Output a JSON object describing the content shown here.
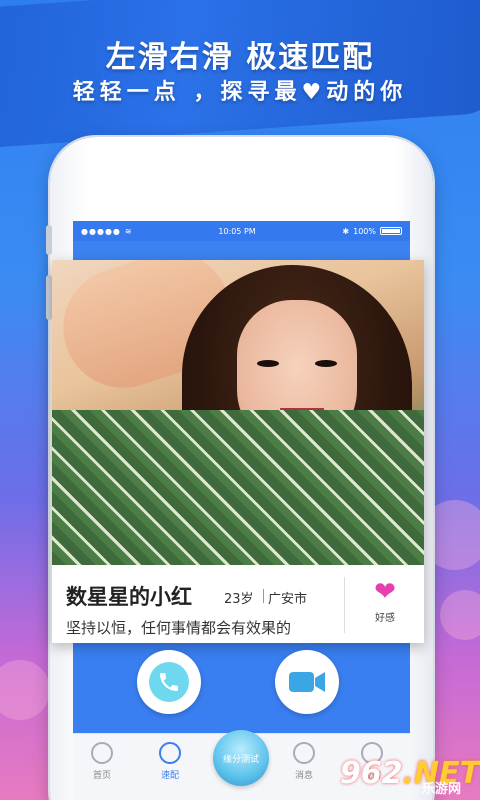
{
  "hero": {
    "line1": "左滑右滑 极速匹配",
    "line2_part1": "轻轻一点 ，探寻最",
    "line2_part2": "动的你"
  },
  "status_bar": {
    "signal": "●●●●●",
    "time": "10:05 PM",
    "battery": "100%"
  },
  "profile": {
    "name": "数星星的小红",
    "age": "23岁",
    "city": "广安市",
    "bio": "坚持以恒，任何事情都会有效果的",
    "like_label": "好感"
  },
  "tabs": [
    {
      "label": "首页"
    },
    {
      "label": "速配"
    },
    {
      "label": "缘分测试"
    },
    {
      "label": "消息"
    },
    {
      "label": "我的"
    }
  ],
  "watermark": {
    "logo_num": "962",
    "logo_suffix": ".NET",
    "sub": "乐游网"
  },
  "colors": {
    "accent": "#3a7ff1",
    "like": "#e83fb0"
  }
}
